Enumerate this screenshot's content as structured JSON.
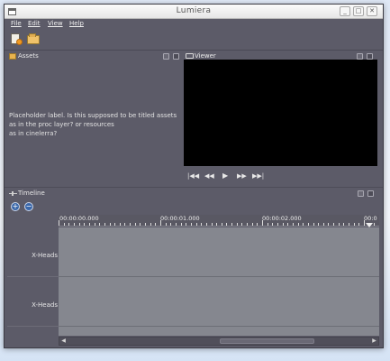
{
  "window": {
    "title": "Lumiera"
  },
  "window_controls": {
    "minimize": "_",
    "maximize": "□",
    "close": "✕"
  },
  "menu": [
    {
      "label": "File"
    },
    {
      "label": "Edit"
    },
    {
      "label": "View"
    },
    {
      "label": "Help"
    }
  ],
  "toolbar": {
    "icons": [
      "new-project-icon",
      "open-project-icon"
    ]
  },
  "assets": {
    "title": "Assets",
    "placeholder_line1": "Placeholder label. Is this supposed to be titled assets",
    "placeholder_line2": "as in the proc layer? or resources",
    "placeholder_line3": "as in cinelerra?"
  },
  "viewer": {
    "title": "Viewer",
    "transport": {
      "rewind_to_start": "|◀◀",
      "rewind": "◀◀",
      "play": "▶",
      "fast_forward": "▶▶",
      "forward_to_end": "▶▶|"
    }
  },
  "timeline": {
    "title": "Timeline",
    "ruler_labels": [
      "00:00:00.000",
      "00:00:01.000",
      "00:00:02.000",
      "00:0"
    ],
    "tracks": [
      {
        "label": "X-Heads"
      },
      {
        "label": "X-Heads"
      }
    ]
  },
  "colors": {
    "window_bg": "#5c5b68",
    "viewer_bg": "#000000",
    "track_bg": "#85878f"
  }
}
